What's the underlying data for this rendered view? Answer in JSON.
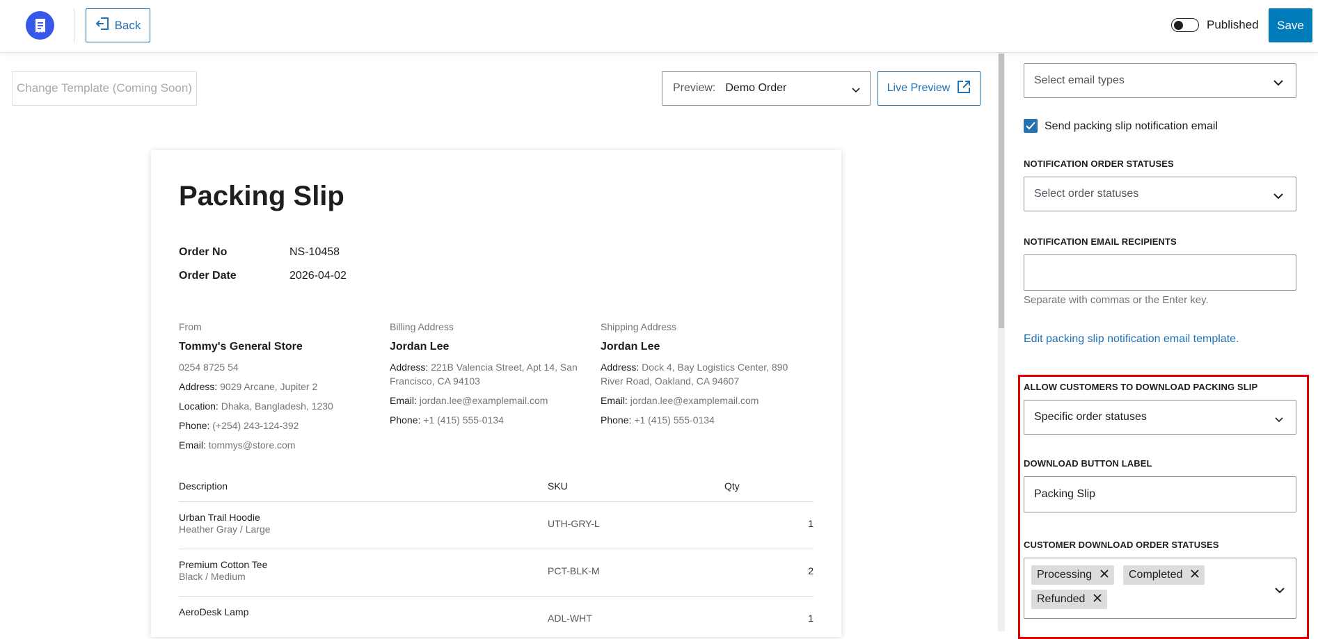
{
  "topbar": {
    "back_label": "Back",
    "published_label": "Published",
    "save_label": "Save"
  },
  "toolbar": {
    "change_template_label": "Change Template (Coming Soon)",
    "preview_label": "Preview:",
    "preview_value": "Demo Order",
    "live_preview_label": "Live Preview"
  },
  "doc": {
    "title": "Packing Slip",
    "order_no_label": "Order No",
    "order_no": "NS-10458",
    "order_date_label": "Order Date",
    "order_date": "2026-04-02",
    "from": {
      "heading": "From",
      "name": "Tommy's General Store",
      "phone_main": "0254 8725 54",
      "address_key": "Address:",
      "address": " 9029 Arcane, Jupiter 2",
      "location_key": "Location:",
      "location": " Dhaka, Bangladesh, 1230",
      "phone_key": "Phone:",
      "phone": " (+254) 243-124-392",
      "email_key": "Email:",
      "email": " tommys@store.com"
    },
    "billing": {
      "heading": "Billing Address",
      "name": "Jordan Lee",
      "address_key": "Address:",
      "address": " 221B Valencia Street, Apt 14, San Francisco, CA 94103",
      "email_key": "Email:",
      "email": " jordan.lee@examplemail.com",
      "phone_key": "Phone:",
      "phone": " +1 (415) 555-0134"
    },
    "shipping": {
      "heading": "Shipping Address",
      "name": "Jordan Lee",
      "address_key": "Address:",
      "address": " Dock 4, Bay Logistics Center, 890 River Road, Oakland, CA 94607",
      "email_key": "Email:",
      "email": " jordan.lee@examplemail.com",
      "phone_key": "Phone:",
      "phone": " +1 (415) 555-0134"
    },
    "table": {
      "headers": [
        "Description",
        "SKU",
        "Qty"
      ],
      "rows": [
        {
          "name": "Urban Trail Hoodie",
          "variant": "Heather Gray / Large",
          "sku": "UTH-GRY-L",
          "qty": "1"
        },
        {
          "name": "Premium Cotton Tee",
          "variant": "Black / Medium",
          "sku": "PCT-BLK-M",
          "qty": "2"
        },
        {
          "name": "AeroDesk Lamp",
          "variant": "",
          "sku": "ADL-WHT",
          "qty": "1"
        }
      ]
    }
  },
  "panel": {
    "email_types_placeholder": "Select email types",
    "send_notification_label": "Send packing slip notification email",
    "send_notification_checked": true,
    "notification_statuses_label": "NOTIFICATION ORDER STATUSES",
    "notification_statuses_placeholder": "Select order statuses",
    "recipients_label": "NOTIFICATION EMAIL RECIPIENTS",
    "recipients_value": "",
    "recipients_help": "Separate with commas or the Enter key.",
    "edit_template_link": "Edit packing slip notification email template.",
    "allow_download_label": "ALLOW CUSTOMERS TO DOWNLOAD PACKING SLIP",
    "allow_download_value": "Specific order statuses",
    "button_label_label": "DOWNLOAD BUTTON LABEL",
    "button_label_value": "Packing Slip",
    "customer_statuses_label": "CUSTOMER DOWNLOAD ORDER STATUSES",
    "customer_statuses": [
      "Processing",
      "Completed",
      "Refunded"
    ]
  },
  "colors": {
    "accent": "#007cba",
    "link": "#2271b1",
    "logo": "#3858e9",
    "highlight": "#e00000"
  }
}
